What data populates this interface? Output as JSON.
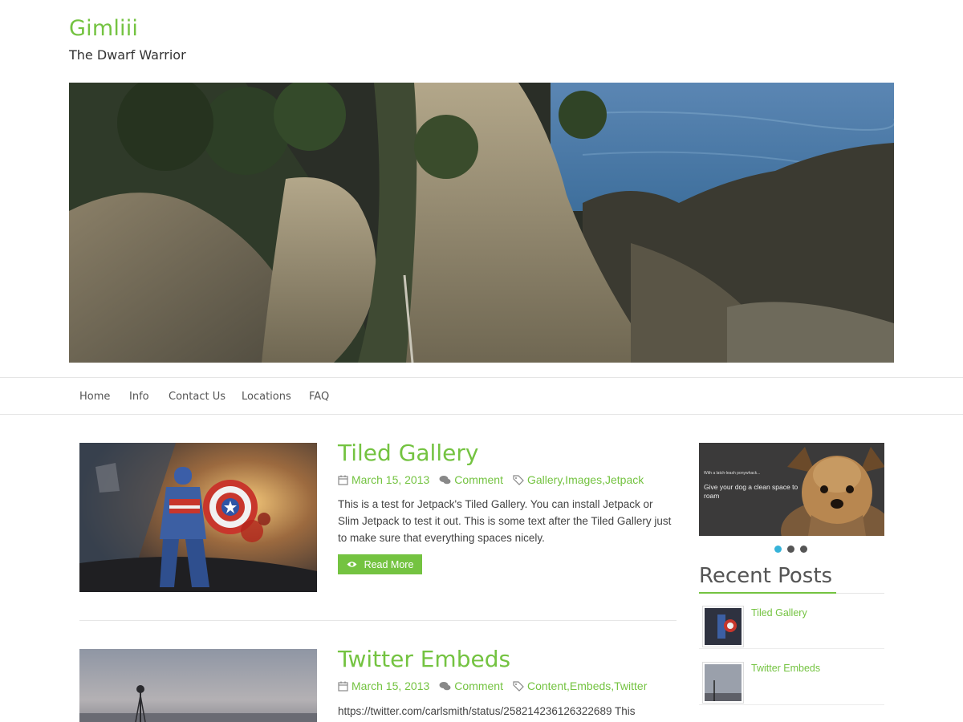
{
  "site": {
    "title": "Gimliii",
    "tagline": "The Dwarf Warrior"
  },
  "nav": [
    "Home",
    "Info",
    "Contact Us",
    "Locations",
    "FAQ"
  ],
  "posts": [
    {
      "title": "Tiled Gallery",
      "date": "March 15, 2013",
      "comment": "Comment",
      "categories": "Gallery,Images,Jetpack",
      "excerpt": "This is a test for Jetpack's Tiled Gallery. You can install Jetpack or Slim Jetpack to test it out. This is some text after the Tiled Gallery just to make sure that everything spaces nicely.",
      "read_more": "Read More"
    },
    {
      "title": "Twitter Embeds",
      "date": "March 15, 2013",
      "comment": "Comment",
      "categories": "Content,Embeds,Twitter",
      "excerpt": "https://twitter.com/carlsmith/status/258214236126322689 This"
    }
  ],
  "slider": {
    "small_text": "With a latch-leash ponywhack...",
    "caption": "Give your dog a clean space to roam",
    "active_dot": 0
  },
  "recent_posts": {
    "title": "Recent Posts",
    "items": [
      "Tiled Gallery",
      "Twitter Embeds"
    ]
  },
  "colors": {
    "accent": "#74c341",
    "dot_active": "#36b3d9"
  }
}
